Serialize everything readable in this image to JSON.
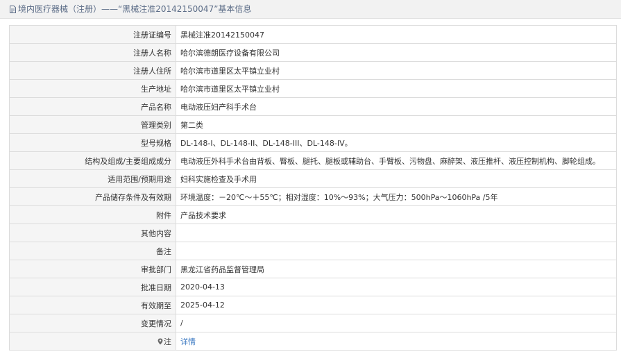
{
  "header": {
    "title": "境内医疗器械（注册）——“黑械注准20142150047”基本信息"
  },
  "rows": [
    {
      "label": "注册证编号",
      "value": "黑械注准20142150047"
    },
    {
      "label": "注册人名称",
      "value": "哈尔滨德朗医疗设备有限公司"
    },
    {
      "label": "注册人住所",
      "value": "哈尔滨市道里区太平镇立业村"
    },
    {
      "label": "生产地址",
      "value": "哈尔滨市道里区太平镇立业村"
    },
    {
      "label": "产品名称",
      "value": "电动液压妇产科手术台"
    },
    {
      "label": "管理类别",
      "value": "第二类"
    },
    {
      "label": "型号规格",
      "value": "DL-148-I、DL-148-II、DL-148-III、DL-148-IV。"
    },
    {
      "label": "结构及组成/主要组成成分",
      "value": "电动液压外科手术台由背板、臀板、腿托、腿板或辅助台、手臂板、污物盘、麻醉架、液压推杆、液压控制机构、脚轮组成。"
    },
    {
      "label": "适用范围/预期用途",
      "value": "妇科实施检查及手术用"
    },
    {
      "label": "产品储存条件及有效期",
      "value": "环境温度：－20℃～＋55℃；相对湿度：10%～93%；大气压力：500hPa～1060hPa /5年"
    },
    {
      "label": "附件",
      "value": "产品技术要求"
    },
    {
      "label": "其他内容",
      "value": ""
    },
    {
      "label": "备注",
      "value": ""
    },
    {
      "label": "审批部门",
      "value": "黑龙江省药品监督管理局"
    },
    {
      "label": "批准日期",
      "value": "2020-04-13"
    },
    {
      "label": "有效期至",
      "value": "2025-04-12"
    },
    {
      "label": "变更情况",
      "value": "/"
    }
  ],
  "note_row": {
    "label": "注",
    "icon": "location-pin-icon",
    "link_text": "详情"
  },
  "colors": {
    "header_bg": "#f2f2f2",
    "header_text": "#5a6b86",
    "label_bg": "#f5f5f5",
    "border": "#dcdcdc",
    "link": "#3a78c2"
  }
}
